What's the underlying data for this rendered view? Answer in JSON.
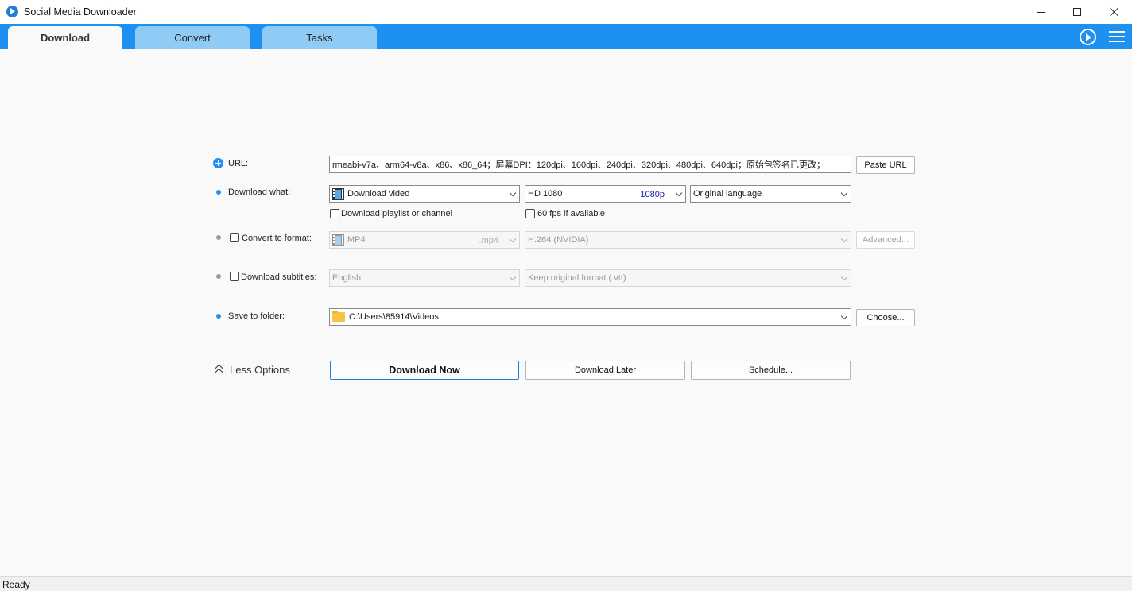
{
  "window": {
    "title": "Social Media Downloader"
  },
  "tabs": [
    {
      "label": "Download",
      "active": true
    },
    {
      "label": "Convert",
      "active": false
    },
    {
      "label": "Tasks",
      "active": false
    }
  ],
  "form": {
    "url": {
      "label": "URL:",
      "value": "rmeabi-v7a、arm64-v8a、x86、x86_64；屏幕DPI：120dpi、160dpi、240dpi、320dpi、480dpi、640dpi；原始包签名已更改；",
      "paste_button": "Paste URL"
    },
    "download_what": {
      "label": "Download what:",
      "type": "Download video",
      "quality": "HD 1080",
      "quality_tag": "1080p",
      "language": "Original language",
      "playlist_label": "Download playlist or channel",
      "fps_label": "60 fps if available"
    },
    "convert": {
      "label": "Convert to format:",
      "format": "MP4",
      "format_ext": ".mp4",
      "codec": "H.264 (NVIDIA)",
      "advanced_button": "Advanced..."
    },
    "subtitles": {
      "label": "Download subtitles:",
      "language": "English",
      "format": "Keep original format (.vtt)"
    },
    "save": {
      "label": "Save to folder:",
      "path": "C:\\Users\\85914\\Videos",
      "choose_button": "Choose..."
    },
    "less_options": "Less Options",
    "actions": {
      "download_now": "Download Now",
      "download_later": "Download Later",
      "schedule": "Schedule..."
    }
  },
  "status": {
    "text": "Ready"
  },
  "colors": {
    "accent": "#1e90f0",
    "tab_inactive": "#8fcbf5",
    "primary_border": "#1e7fd8"
  }
}
